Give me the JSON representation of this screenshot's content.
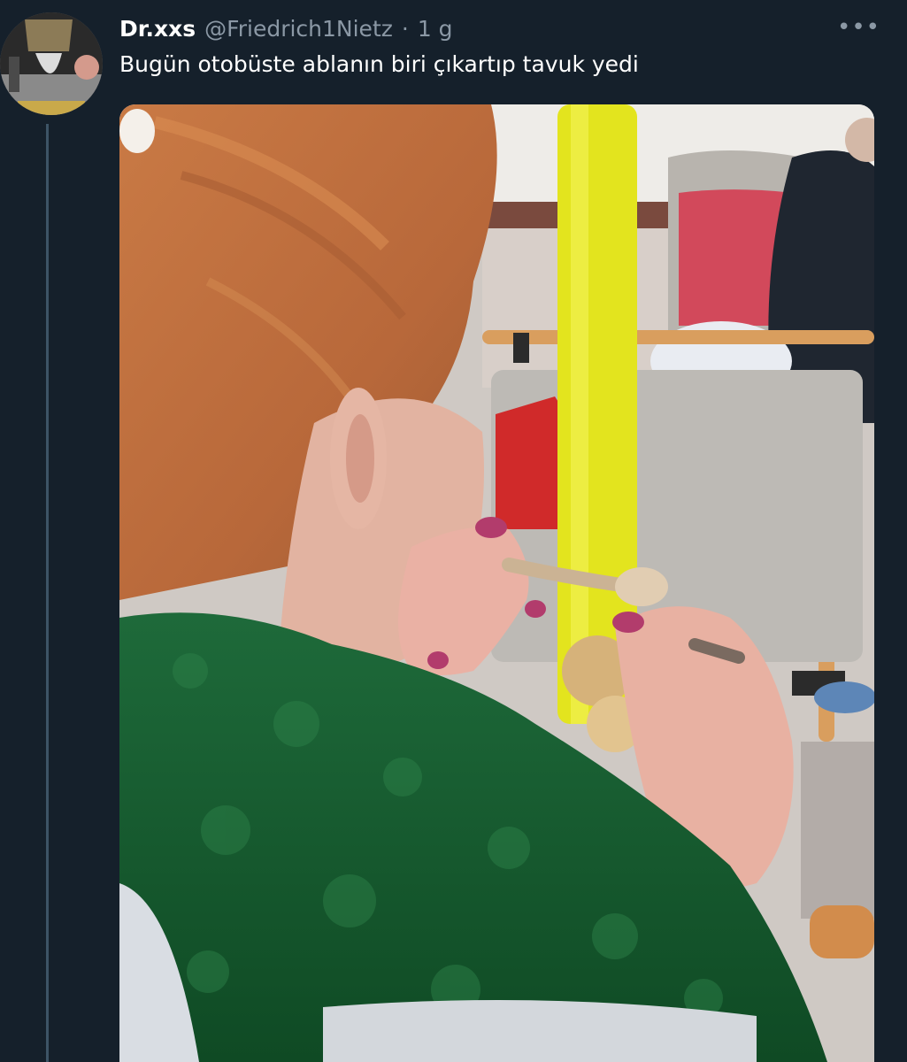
{
  "tweet": {
    "display_name": "Dr.xxs",
    "handle": "@Friedrich1Nietz",
    "separator": "·",
    "time": "1 g",
    "text": "Bugün otobüste ablanın biri çıkartıp tavuk yedi",
    "more_icon": "more-horizontal-icon",
    "avatar_icon": "avatar-image"
  },
  "media": {
    "image": "photo"
  },
  "colors": {
    "background": "#15202b",
    "text": "#ffffff",
    "secondary_text": "#8b98a5"
  }
}
